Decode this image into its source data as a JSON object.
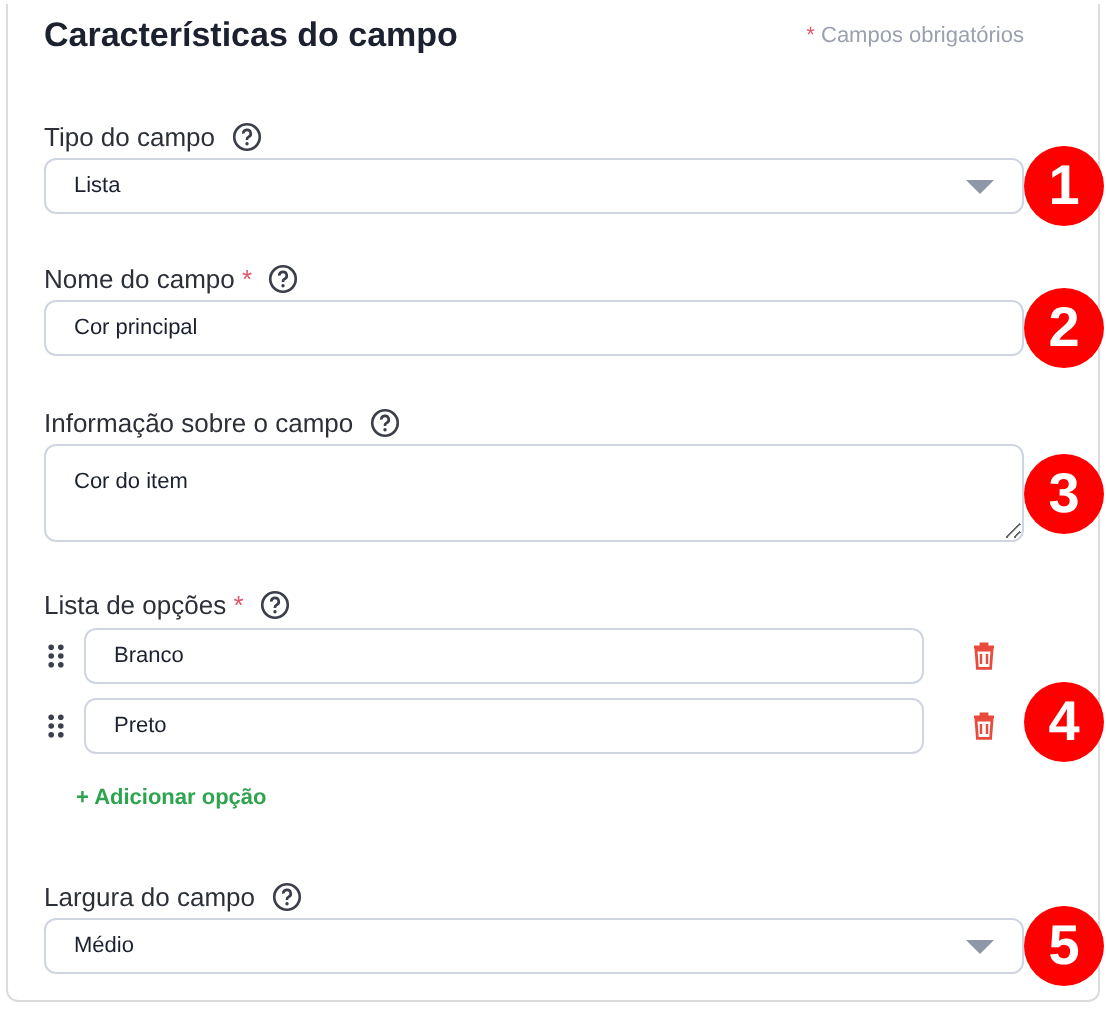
{
  "header": {
    "title": "Características do campo",
    "required_note": {
      "mark": "*",
      "text": "Campos obrigatórios"
    }
  },
  "fields": [
    {
      "kind": "select",
      "label": "Tipo do campo",
      "required": false,
      "value": "Lista",
      "badge": "1"
    },
    {
      "kind": "text",
      "label": "Nome do campo",
      "required": true,
      "value": "Cor principal",
      "badge": "2"
    },
    {
      "kind": "textarea",
      "label": "Informação sobre o campo",
      "required": false,
      "value": "Cor do item",
      "badge": "3"
    },
    {
      "kind": "options",
      "label": "Lista de opções",
      "required": true,
      "options": [
        "Branco",
        "Preto"
      ],
      "add_label": "+ Adicionar opção",
      "badge": "4"
    },
    {
      "kind": "select",
      "label": "Largura do campo",
      "required": false,
      "value": "Médio",
      "badge": "5"
    }
  ]
}
